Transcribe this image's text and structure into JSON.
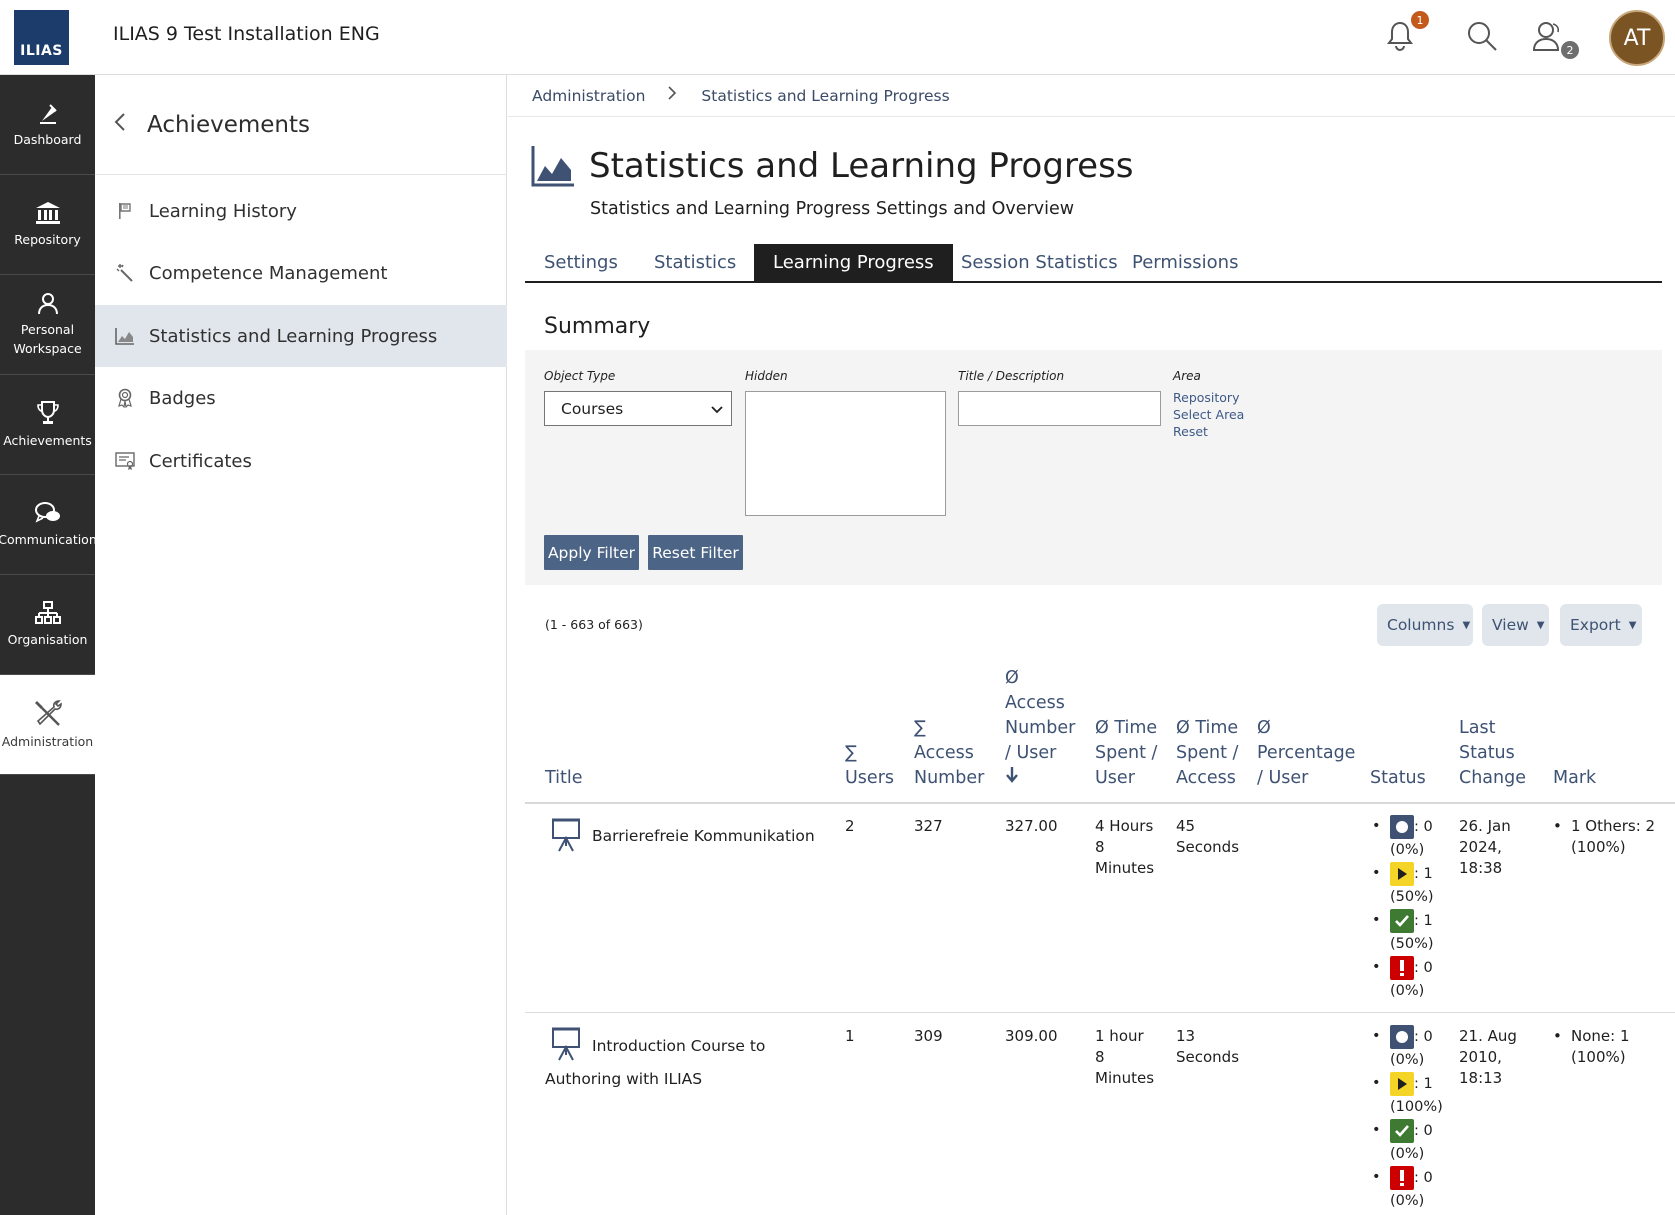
{
  "header": {
    "logo_text": "ILIAS",
    "title": "ILIAS 9 Test Installation ENG",
    "notification_count": "1",
    "contacts_count": "2",
    "avatar_initials": "AT"
  },
  "mainbar": {
    "items": [
      {
        "label": "Dashboard",
        "icon": "dashboard-icon"
      },
      {
        "label": "Repository",
        "icon": "repository-icon"
      },
      {
        "label": "Personal Workspace",
        "icon": "personal-workspace-icon"
      },
      {
        "label": "Achievements",
        "icon": "trophy-icon"
      },
      {
        "label": "Communication",
        "icon": "communication-icon"
      },
      {
        "label": "Organisation",
        "icon": "organisation-icon"
      },
      {
        "label": "Administration",
        "icon": "administration-icon"
      }
    ]
  },
  "slate": {
    "title": "Achievements",
    "items": [
      {
        "label": "Learning History",
        "icon": "flag-icon"
      },
      {
        "label": "Competence Management",
        "icon": "wand-icon"
      },
      {
        "label": "Statistics and Learning Progress",
        "icon": "chart-icon"
      },
      {
        "label": "Badges",
        "icon": "badge-icon"
      },
      {
        "label": "Certificates",
        "icon": "certificate-icon"
      }
    ]
  },
  "breadcrumb": [
    "Administration",
    "Statistics and Learning Progress"
  ],
  "page": {
    "title": "Statistics and Learning Progress",
    "description": "Statistics and Learning Progress Settings and Overview"
  },
  "tabs": [
    "Settings",
    "Statistics",
    "Learning Progress",
    "Session Statistics",
    "Permissions"
  ],
  "active_tab": "Learning Progress",
  "summary": {
    "title": "Summary",
    "filter": {
      "object_type_label": "Object Type",
      "object_type_value": "Courses",
      "hidden_label": "Hidden",
      "title_description_label": "Title / Description",
      "title_description_value": "",
      "area_label": "Area",
      "area_links": [
        "Repository",
        "Select Area",
        "Reset"
      ],
      "apply_label": "Apply Filter",
      "reset_label": "Reset Filter"
    }
  },
  "table": {
    "count_text": "(1 - 663 of 663)",
    "controls": [
      "Columns",
      "View",
      "Export"
    ],
    "headers": {
      "title": "Title",
      "users": [
        "∑",
        "Users"
      ],
      "access_number": [
        "∑",
        "Access",
        "Number"
      ],
      "avg_access": [
        "Ø",
        "Access",
        "Number",
        "/ User"
      ],
      "time_spent_user": [
        "Ø Time",
        "Spent /",
        "User"
      ],
      "time_spent_access": [
        "Ø Time",
        "Spent /",
        "Access"
      ],
      "percentage_user": [
        "Ø",
        "Percentage",
        "/ User"
      ],
      "status": "Status",
      "last_status_change": [
        "Last",
        "Status",
        "Change"
      ],
      "mark": "Mark"
    },
    "rows": [
      {
        "title_line1": "Barrierefreie Kommunikation",
        "title_line2": "",
        "users": "2",
        "access_number": "327",
        "avg_access": "327.00",
        "time_user": [
          "4 Hours",
          "8",
          "Minutes"
        ],
        "time_access": [
          "45",
          "Seconds"
        ],
        "percentage": "",
        "status": [
          {
            "icon": "not-attempted-icon",
            "count": ": 0",
            "pct": "(0%)"
          },
          {
            "icon": "in-progress-icon",
            "count": ": 1",
            "pct": "(50%)"
          },
          {
            "icon": "completed-icon",
            "count": ": 1",
            "pct": "(50%)"
          },
          {
            "icon": "failed-icon",
            "count": ": 0",
            "pct": "(0%)"
          }
        ],
        "last_change": [
          "26. Jan",
          "2024,",
          "18:38"
        ],
        "mark": [
          "1 Others: 2",
          "(100%)"
        ]
      },
      {
        "title_line1": "Introduction Course to",
        "title_line2": "Authoring with ILIAS",
        "users": "1",
        "access_number": "309",
        "avg_access": "309.00",
        "time_user": [
          "1 hour",
          "8",
          "Minutes"
        ],
        "time_access": [
          "13",
          "Seconds"
        ],
        "percentage": "",
        "status": [
          {
            "icon": "not-attempted-icon",
            "count": ": 0",
            "pct": "(0%)"
          },
          {
            "icon": "in-progress-icon",
            "count": ": 1",
            "pct": "(100%)"
          },
          {
            "icon": "completed-icon",
            "count": ": 0",
            "pct": "(0%)"
          },
          {
            "icon": "failed-icon",
            "count": ": 0",
            "pct": "(0%)"
          }
        ],
        "last_change": [
          "21. Aug",
          "2010,",
          "18:13"
        ],
        "mark": [
          "None: 1",
          "(100%)"
        ]
      }
    ]
  },
  "colors": {
    "mainbar_bg": "#2c2c2c",
    "logo_bg": "#1c3d6b",
    "link": "#3e5273",
    "button": "#4c6586",
    "notification_badge": "#c35a1c",
    "status_not_attempted": "#3f5273",
    "status_in_progress": "#f5d428",
    "status_completed": "#3f7a33",
    "status_failed": "#cc0000"
  }
}
